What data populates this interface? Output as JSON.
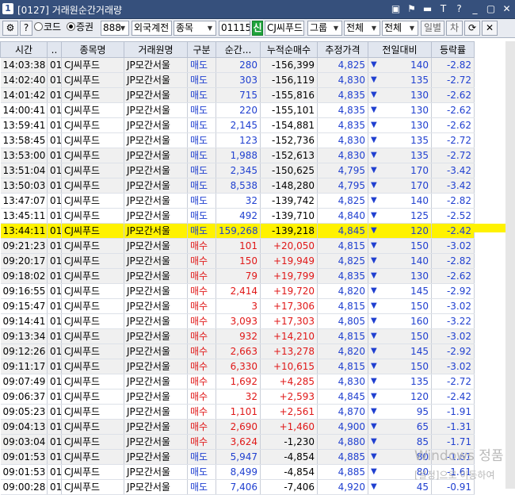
{
  "window": {
    "app_number": "1",
    "title": "[0127] 거래원순간거래량",
    "title_icons": [
      "restore-icon",
      "flag-icon",
      "minimize-icon",
      "text-icon",
      "help-icon",
      "minimize-window-icon",
      "maximize-window-icon",
      "close-window-icon"
    ],
    "title_icon_glyphs": [
      "▣",
      "⚑",
      "▬",
      "T",
      "?",
      "_",
      "▢",
      "✕"
    ]
  },
  "toolbar": {
    "settings_glyph": "⚙",
    "help_label": "?",
    "radio_code_label": "코드",
    "radio_stock_label": "증권",
    "broker_code": "888",
    "account_type": "외국계전",
    "item_type": "종목",
    "stock_code": "011150",
    "sin_label": "신",
    "stock_name": "CJ씨푸드",
    "group_label": "그룹",
    "filter1": "전체",
    "filter2": "전체",
    "daily_label": "일별",
    "diff_label": "차",
    "refresh_glyph": "⟳",
    "close_glyph": "✕"
  },
  "table": {
    "columns": [
      "시간",
      "..",
      "종목명",
      "거래원명",
      "구분",
      "순간...",
      "누적순매수",
      "추정가격",
      "전일대비",
      "등락률"
    ],
    "rows": [
      {
        "time": "14:03:38",
        "code": "01",
        "name": "CJ씨푸드",
        "broker": "JP모간서울",
        "type": "매도",
        "qty": "280",
        "cum": "-156,399",
        "price": "4,825",
        "diff": "140",
        "rate": "-2.82"
      },
      {
        "time": "14:02:40",
        "code": "01",
        "name": "CJ씨푸드",
        "broker": "JP모간서울",
        "type": "매도",
        "qty": "303",
        "cum": "-156,119",
        "price": "4,830",
        "diff": "135",
        "rate": "-2.72"
      },
      {
        "time": "14:01:42",
        "code": "01",
        "name": "CJ씨푸드",
        "broker": "JP모간서울",
        "type": "매도",
        "qty": "715",
        "cum": "-155,816",
        "price": "4,835",
        "diff": "130",
        "rate": "-2.62"
      },
      {
        "time": "14:00:41",
        "code": "01",
        "name": "CJ씨푸드",
        "broker": "JP모간서울",
        "type": "매도",
        "qty": "220",
        "cum": "-155,101",
        "price": "4,835",
        "diff": "130",
        "rate": "-2.62"
      },
      {
        "time": "13:59:41",
        "code": "01",
        "name": "CJ씨푸드",
        "broker": "JP모간서울",
        "type": "매도",
        "qty": "2,145",
        "cum": "-154,881",
        "price": "4,835",
        "diff": "130",
        "rate": "-2.62"
      },
      {
        "time": "13:58:45",
        "code": "01",
        "name": "CJ씨푸드",
        "broker": "JP모간서울",
        "type": "매도",
        "qty": "123",
        "cum": "-152,736",
        "price": "4,830",
        "diff": "135",
        "rate": "-2.72"
      },
      {
        "time": "13:53:00",
        "code": "01",
        "name": "CJ씨푸드",
        "broker": "JP모간서울",
        "type": "매도",
        "qty": "1,988",
        "cum": "-152,613",
        "price": "4,830",
        "diff": "135",
        "rate": "-2.72"
      },
      {
        "time": "13:51:04",
        "code": "01",
        "name": "CJ씨푸드",
        "broker": "JP모간서울",
        "type": "매도",
        "qty": "2,345",
        "cum": "-150,625",
        "price": "4,795",
        "diff": "170",
        "rate": "-3.42"
      },
      {
        "time": "13:50:03",
        "code": "01",
        "name": "CJ씨푸드",
        "broker": "JP모간서울",
        "type": "매도",
        "qty": "8,538",
        "cum": "-148,280",
        "price": "4,795",
        "diff": "170",
        "rate": "-3.42"
      },
      {
        "time": "13:47:07",
        "code": "01",
        "name": "CJ씨푸드",
        "broker": "JP모간서울",
        "type": "매도",
        "qty": "32",
        "cum": "-139,742",
        "price": "4,825",
        "diff": "140",
        "rate": "-2.82"
      },
      {
        "time": "13:45:11",
        "code": "01",
        "name": "CJ씨푸드",
        "broker": "JP모간서울",
        "type": "매도",
        "qty": "492",
        "cum": "-139,710",
        "price": "4,840",
        "diff": "125",
        "rate": "-2.52"
      },
      {
        "time": "13:44:11",
        "code": "01",
        "name": "CJ씨푸드",
        "broker": "JP모간서울",
        "type": "매도",
        "qty": "159,268",
        "cum": "-139,218",
        "price": "4,845",
        "diff": "120",
        "rate": "-2.42",
        "highlight": true
      },
      {
        "time": "09:21:23",
        "code": "01",
        "name": "CJ씨푸드",
        "broker": "JP모간서울",
        "type": "매수",
        "qty": "101",
        "cum": "+20,050",
        "price": "4,815",
        "diff": "150",
        "rate": "-3.02"
      },
      {
        "time": "09:20:17",
        "code": "01",
        "name": "CJ씨푸드",
        "broker": "JP모간서울",
        "type": "매수",
        "qty": "150",
        "cum": "+19,949",
        "price": "4,825",
        "diff": "140",
        "rate": "-2.82"
      },
      {
        "time": "09:18:02",
        "code": "01",
        "name": "CJ씨푸드",
        "broker": "JP모간서울",
        "type": "매수",
        "qty": "79",
        "cum": "+19,799",
        "price": "4,835",
        "diff": "130",
        "rate": "-2.62"
      },
      {
        "time": "09:16:55",
        "code": "01",
        "name": "CJ씨푸드",
        "broker": "JP모간서울",
        "type": "매수",
        "qty": "2,414",
        "cum": "+19,720",
        "price": "4,820",
        "diff": "145",
        "rate": "-2.92"
      },
      {
        "time": "09:15:47",
        "code": "01",
        "name": "CJ씨푸드",
        "broker": "JP모간서울",
        "type": "매수",
        "qty": "3",
        "cum": "+17,306",
        "price": "4,815",
        "diff": "150",
        "rate": "-3.02"
      },
      {
        "time": "09:14:41",
        "code": "01",
        "name": "CJ씨푸드",
        "broker": "JP모간서울",
        "type": "매수",
        "qty": "3,093",
        "cum": "+17,303",
        "price": "4,805",
        "diff": "160",
        "rate": "-3.22"
      },
      {
        "time": "09:13:34",
        "code": "01",
        "name": "CJ씨푸드",
        "broker": "JP모간서울",
        "type": "매수",
        "qty": "932",
        "cum": "+14,210",
        "price": "4,815",
        "diff": "150",
        "rate": "-3.02"
      },
      {
        "time": "09:12:26",
        "code": "01",
        "name": "CJ씨푸드",
        "broker": "JP모간서울",
        "type": "매수",
        "qty": "2,663",
        "cum": "+13,278",
        "price": "4,820",
        "diff": "145",
        "rate": "-2.92"
      },
      {
        "time": "09:11:17",
        "code": "01",
        "name": "CJ씨푸드",
        "broker": "JP모간서울",
        "type": "매수",
        "qty": "6,330",
        "cum": "+10,615",
        "price": "4,815",
        "diff": "150",
        "rate": "-3.02"
      },
      {
        "time": "09:07:49",
        "code": "01",
        "name": "CJ씨푸드",
        "broker": "JP모간서울",
        "type": "매수",
        "qty": "1,692",
        "cum": "+4,285",
        "price": "4,830",
        "diff": "135",
        "rate": "-2.72"
      },
      {
        "time": "09:06:37",
        "code": "01",
        "name": "CJ씨푸드",
        "broker": "JP모간서울",
        "type": "매수",
        "qty": "32",
        "cum": "+2,593",
        "price": "4,845",
        "diff": "120",
        "rate": "-2.42"
      },
      {
        "time": "09:05:23",
        "code": "01",
        "name": "CJ씨푸드",
        "broker": "JP모간서울",
        "type": "매수",
        "qty": "1,101",
        "cum": "+2,561",
        "price": "4,870",
        "diff": "95",
        "rate": "-1.91"
      },
      {
        "time": "09:04:13",
        "code": "01",
        "name": "CJ씨푸드",
        "broker": "JP모간서울",
        "type": "매수",
        "qty": "2,690",
        "cum": "+1,460",
        "price": "4,900",
        "diff": "65",
        "rate": "-1.31"
      },
      {
        "time": "09:03:04",
        "code": "01",
        "name": "CJ씨푸드",
        "broker": "JP모간서울",
        "type": "매수",
        "qty": "3,624",
        "cum": "-1,230",
        "price": "4,880",
        "diff": "85",
        "rate": "-1.71"
      },
      {
        "time": "09:01:53",
        "code": "01",
        "name": "CJ씨푸드",
        "broker": "JP모간서울",
        "type": "매도",
        "qty": "5,947",
        "cum": "-4,854",
        "price": "4,885",
        "diff": "80",
        "rate": "-1.61"
      },
      {
        "time": "09:01:53",
        "code": "01",
        "name": "CJ씨푸드",
        "broker": "JP모간서울",
        "type": "매도",
        "qty": "8,499",
        "cum": "-4,854",
        "price": "4,885",
        "diff": "80",
        "rate": "-1.61"
      },
      {
        "time": "09:00:28",
        "code": "01",
        "name": "CJ씨푸드",
        "broker": "JP모간서울",
        "type": "매도",
        "qty": "7,406",
        "cum": "-7,406",
        "price": "4,920",
        "diff": "45",
        "rate": "-0.91"
      }
    ]
  },
  "watermark": {
    "line1": "Windows 정품",
    "line2": "[설정]으로 이동하여"
  },
  "colors": {
    "sell": "#2040d0",
    "buy": "#e01818",
    "highlight": "#fff200",
    "down_arrow": "#2040d0",
    "header_bg": "#e1e6ef",
    "title_bg": "#36507c"
  }
}
